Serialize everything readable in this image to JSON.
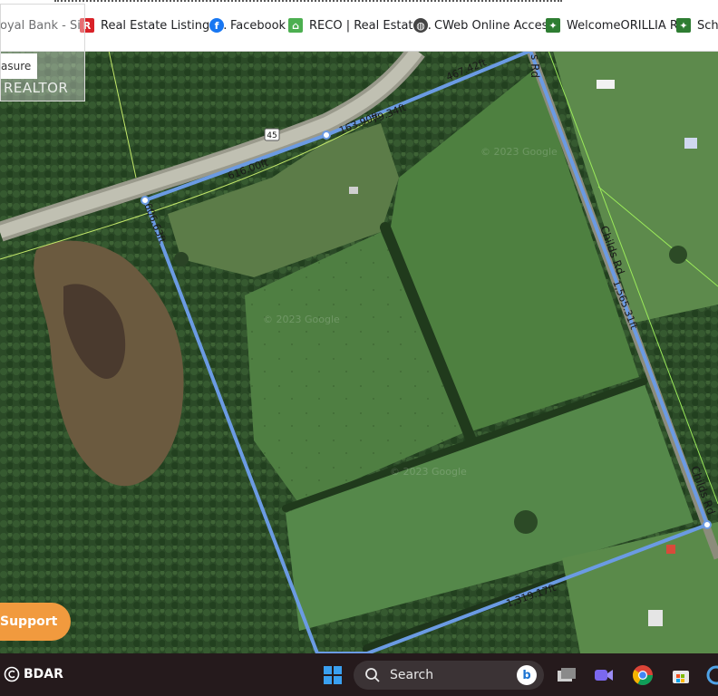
{
  "bookmarks": [
    {
      "label": "oyal Bank - Si...",
      "icon": "rbc-icon",
      "color": "#1f4d9e"
    },
    {
      "label": "Real Estate Listings...",
      "icon": "realtor-r-icon",
      "color": "#d92228"
    },
    {
      "label": "Facebook",
      "icon": "facebook-icon",
      "color": "#1877f2"
    },
    {
      "label": "RECO | Real Estate...",
      "icon": "house-icon",
      "color": "#4caf50"
    },
    {
      "label": "CWeb Online Acces...",
      "icon": "globe-icon",
      "color": "#333333"
    },
    {
      "label": "WelcomeORILLIA R...",
      "icon": "leaf-icon",
      "color": "#2e7d32"
    },
    {
      "label": "Sche",
      "icon": "leaf-icon",
      "color": "#2e7d32"
    }
  ],
  "map": {
    "highway_label": "45",
    "road_labels": [
      "s Rd",
      "Childs Rd",
      "Childs Rd"
    ],
    "edge_labels": [
      "467.42ft",
      "163.90ft",
      "79.34ft",
      "616.00ft",
      "606.63ft",
      "1,565.31ft",
      "1,319.17ft"
    ],
    "watermark": "© 2023 Google",
    "boundary_color": "#6b9be3"
  },
  "overlay": {
    "measure_label": "asure",
    "realtor_text": "REALTOR",
    "support_label": "Support"
  },
  "taskbar": {
    "bdar_label": "BDAR",
    "search_placeholder": "Search",
    "icons": [
      "windows-start-icon",
      "bing-icon",
      "task-view-icon",
      "meet-icon",
      "chrome-icon",
      "store-icon",
      "settings-icon"
    ]
  }
}
